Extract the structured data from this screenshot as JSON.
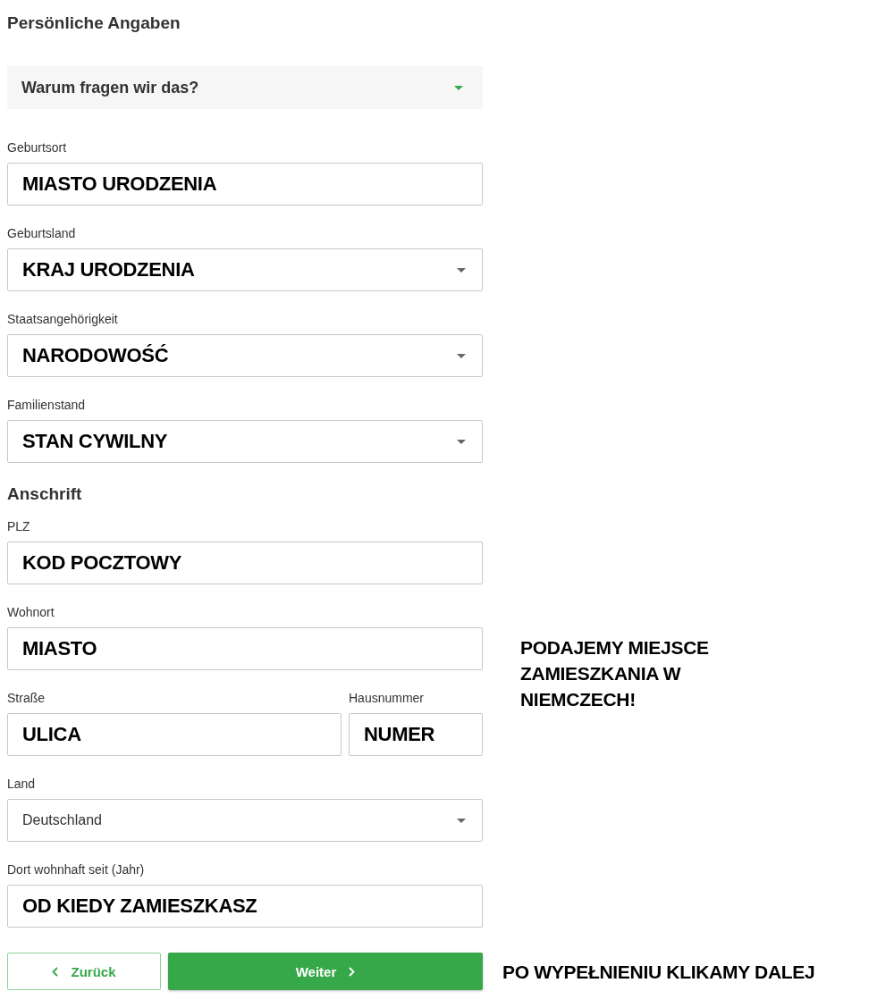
{
  "title": "Persönliche Angaben",
  "accordion": {
    "label": "Warum fragen wir das?",
    "expanded": false
  },
  "rows": [
    {
      "kind": "fields",
      "fields": [
        {
          "label": "Geburtsort",
          "value": "MIASTO URODZENIA",
          "kind": "text"
        }
      ]
    },
    {
      "kind": "fields",
      "fields": [
        {
          "label": "Geburtsland",
          "value": "KRAJ URODZENIA",
          "kind": "select"
        }
      ]
    },
    {
      "kind": "fields",
      "fields": [
        {
          "label": "Staatsangehörigkeit",
          "value": "NARODOWOŚĆ",
          "kind": "select"
        }
      ]
    },
    {
      "kind": "fields",
      "fields": [
        {
          "label": "Familienstand",
          "value": "STAN CYWILNY",
          "kind": "select"
        }
      ]
    },
    {
      "kind": "heading",
      "text": "Anschrift"
    },
    {
      "kind": "fields",
      "fields": [
        {
          "label": "PLZ",
          "value": "KOD POCZTOWY",
          "kind": "text"
        }
      ]
    },
    {
      "kind": "fields",
      "fields": [
        {
          "label": "Wohnort",
          "value": "MIASTO",
          "kind": "text"
        }
      ],
      "note": "PODAJEMY MIEJSCE ZAMIESZKANIA W NIEMCZECH!"
    },
    {
      "kind": "fields",
      "fields": [
        {
          "label": "Straße",
          "value": "ULICA",
          "kind": "text"
        },
        {
          "label": "Hausnummer",
          "value": "NUMER",
          "kind": "text"
        }
      ]
    },
    {
      "kind": "fields",
      "fields": [
        {
          "label": "Land",
          "value": "Deutschland",
          "kind": "select",
          "plain": true
        }
      ]
    },
    {
      "kind": "fields",
      "fields": [
        {
          "label": "Dort wohnhaft seit (Jahr)",
          "value": "OD KIEDY ZAMIESZKASZ",
          "kind": "text"
        }
      ]
    }
  ],
  "back_button": "Zurück",
  "next_button": "Weiter",
  "button_note": "PO WYPEŁNIENIU KLIKAMY DALEJ"
}
